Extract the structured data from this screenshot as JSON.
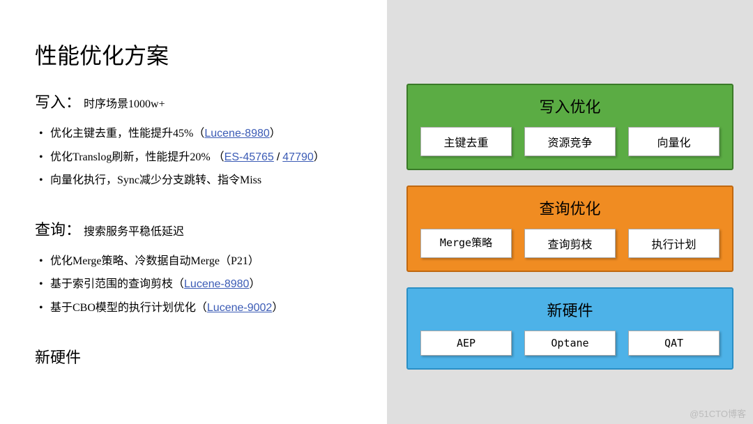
{
  "title": "性能优化方案",
  "write": {
    "heading": "写入：",
    "sub": "时序场景1000w+",
    "items": [
      {
        "pre": "优化主键去重，性能提升45%（",
        "link1": "Lucene-8980",
        "post": "）"
      },
      {
        "pre": "优化Translog刷新，性能提升20% （",
        "link1": "ES-45765",
        "slash": "/",
        "link2": "47790",
        "post": "）"
      },
      {
        "pre": "向量化执行，Sync减少分支跳转、指令Miss"
      }
    ]
  },
  "query": {
    "heading": "查询：",
    "sub": "搜索服务平稳低延迟",
    "items": [
      {
        "pre": "优化Merge策略、冷数据自动Merge（P21）"
      },
      {
        "pre": "基于索引范围的查询剪枝（",
        "link1": "Lucene-8980",
        "post": "）"
      },
      {
        "pre": "基于CBO模型的执行计划优化（",
        "link1": "Lucene-9002",
        "post": "）"
      }
    ]
  },
  "hardware_heading": "新硬件",
  "boxes": {
    "green": {
      "title": "写入优化",
      "chips": [
        "主键去重",
        "资源竞争",
        "向量化"
      ]
    },
    "orange": {
      "title": "查询优化",
      "chips": [
        "Merge策略",
        "查询剪枝",
        "执行计划"
      ]
    },
    "blue": {
      "title": "新硬件",
      "chips": [
        "AEP",
        "Optane",
        "QAT"
      ]
    }
  },
  "watermark": "@51CTO博客"
}
